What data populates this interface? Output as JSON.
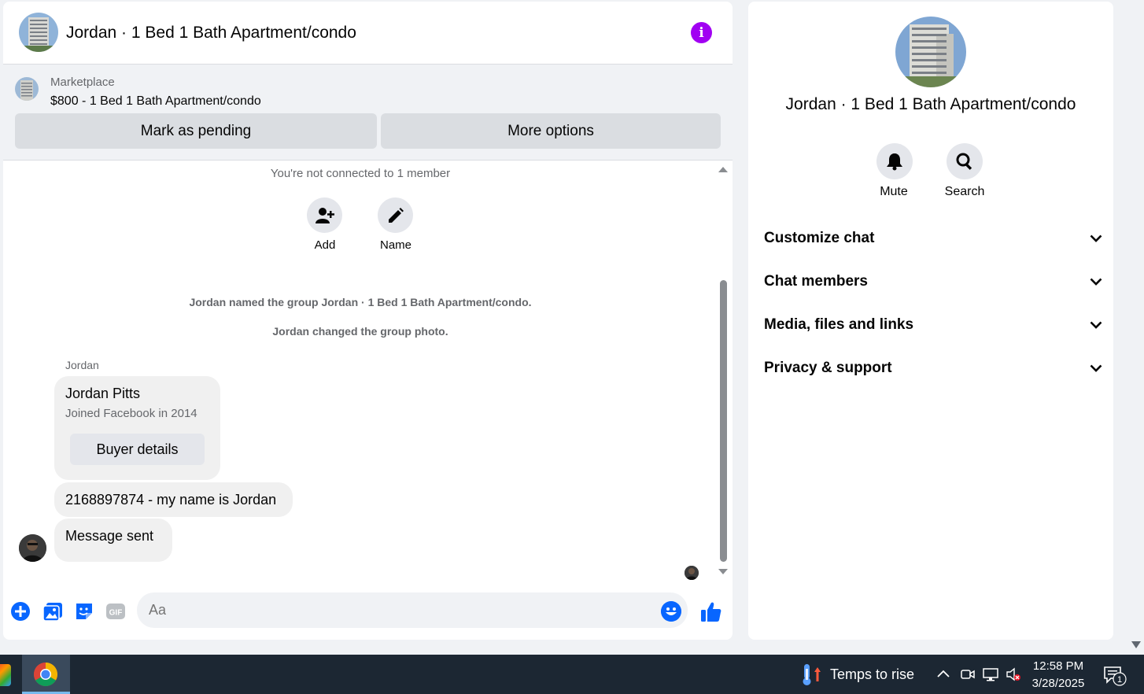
{
  "chat": {
    "title": "Jordan · 1 Bed 1 Bath Apartment/condo",
    "marketplace_label": "Marketplace",
    "listing": "$800 - 1 Bed 1 Bath Apartment/condo",
    "mark_pending": "Mark as pending",
    "more_options": "More options",
    "not_connected": "You're not connected to 1 member",
    "add_label": "Add",
    "name_label": "Name",
    "system_messages": [
      "Jordan named the group Jordan · 1 Bed 1 Bath Apartment/condo.",
      "Jordan changed the group photo."
    ],
    "sender": "Jordan",
    "card": {
      "name": "Jordan Pitts",
      "joined": "Joined Facebook in 2014",
      "buyer_details": "Buyer details"
    },
    "messages": [
      "2168897874 - my name is Jordan",
      "Message sent"
    ],
    "composer_placeholder": "Aa"
  },
  "info": {
    "title": "Jordan · 1 Bed 1 Bath Apartment/condo",
    "mute_label": "Mute",
    "search_label": "Search",
    "sections": [
      "Customize chat",
      "Chat members",
      "Media, files and links",
      "Privacy & support"
    ]
  },
  "taskbar": {
    "weather": "Temps to rise",
    "time": "12:58 PM",
    "date": "3/28/2025",
    "notification_count": "1"
  },
  "colors": {
    "accent": "#0866ff",
    "info_purple": "#a100f2",
    "taskbar": "#1c2733"
  },
  "icons": {
    "info": "info-icon",
    "add_person": "add-person-icon",
    "pencil": "pencil-icon",
    "plus": "plus-circle-icon",
    "photo": "photo-icon",
    "sticker": "sticker-icon",
    "gif": "gif-icon",
    "emoji": "emoji-icon",
    "like": "thumbs-up-icon",
    "bell": "bell-icon",
    "search": "search-icon",
    "chevron": "chevron-down-icon"
  }
}
